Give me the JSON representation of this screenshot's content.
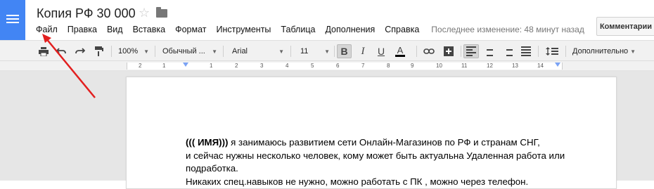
{
  "doc": {
    "title": "Копия РФ 30 000"
  },
  "menu": {
    "items": [
      "Файл",
      "Правка",
      "Вид",
      "Вставка",
      "Формат",
      "Инструменты",
      "Таблица",
      "Дополнения",
      "Справка"
    ],
    "last_edit": "Последнее изменение: 48 минут назад"
  },
  "comments_label": "Комментарии",
  "toolbar": {
    "zoom": "100%",
    "style": "Обычный ...",
    "font": "Arial",
    "size": "11",
    "spacing_label": "Дополнительно",
    "bold": "B",
    "italic": "I",
    "underline": "U",
    "text_color": "A"
  },
  "ruler_numbers": [
    "2",
    "1",
    "1",
    "2",
    "3",
    "4",
    "5",
    "6",
    "7",
    "8",
    "9",
    "10",
    "11",
    "12",
    "13",
    "14",
    "15",
    "16"
  ],
  "body": {
    "line1_bold": "((( ИМЯ)))",
    "line1_rest": " я занимаюсь развитием сети Онлайн-Магазинов по РФ и странам СНГ,",
    "line2": "и сейчас нужны несколько человек,  кому может быть актуальна Удаленная работа или",
    "line3": "подработка.",
    "line4": "Никаких спец.навыков не нужно, можно работать с ПК , можно через телефон."
  },
  "annotation_color": "#e21f1f",
  "accent_color": "#4285f4"
}
